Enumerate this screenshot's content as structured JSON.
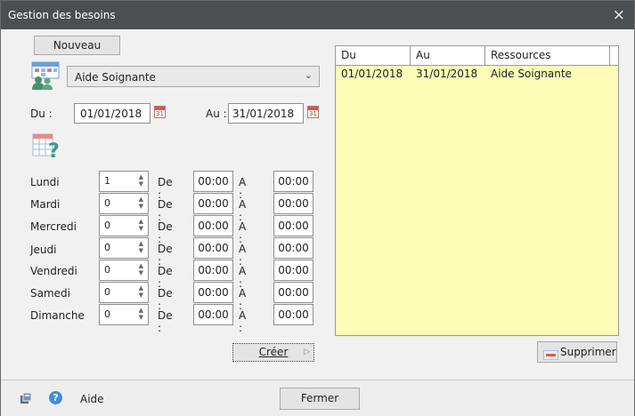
{
  "window": {
    "title": "Gestion des besoins",
    "close_icon": "×"
  },
  "toolbar": {
    "new_label": "Nouveau"
  },
  "resource": {
    "selected": "Aide Soignante",
    "icon": "staff-calendar-icon"
  },
  "dates": {
    "from_label": "Du :",
    "from_value": "01/01/2018",
    "to_label": "Au :",
    "to_value": "31/01/2018",
    "calendar_text": "31"
  },
  "help_grid_icon": "calendar-question-icon",
  "schedule": {
    "de_label": "De :",
    "a_label": "A :",
    "days": [
      {
        "name": "Lundi",
        "count": "1",
        "from": "00:00",
        "to": "00:00"
      },
      {
        "name": "Mardi",
        "count": "0",
        "from": "00:00",
        "to": "00:00"
      },
      {
        "name": "Mercredi",
        "count": "0",
        "from": "00:00",
        "to": "00:00"
      },
      {
        "name": "Jeudi",
        "count": "0",
        "from": "00:00",
        "to": "00:00"
      },
      {
        "name": "Vendredi",
        "count": "0",
        "from": "00:00",
        "to": "00:00"
      },
      {
        "name": "Samedi",
        "count": "0",
        "from": "00:00",
        "to": "00:00"
      },
      {
        "name": "Dimanche",
        "count": "0",
        "from": "00:00",
        "to": "00:00"
      }
    ]
  },
  "create_label": "Créer",
  "grid": {
    "columns": [
      "Du",
      "Au",
      "Ressources"
    ],
    "rows": [
      [
        "01/01/2018",
        "31/01/2018",
        "Aide Soignante"
      ]
    ]
  },
  "delete_label": "Supprimer",
  "footer": {
    "help_label": "Aide",
    "close_label": "Fermer"
  },
  "colors": {
    "titlebar": "#4c4f52",
    "grid_bg": "#fdfdb8",
    "window_bg": "#f1f1f1"
  }
}
